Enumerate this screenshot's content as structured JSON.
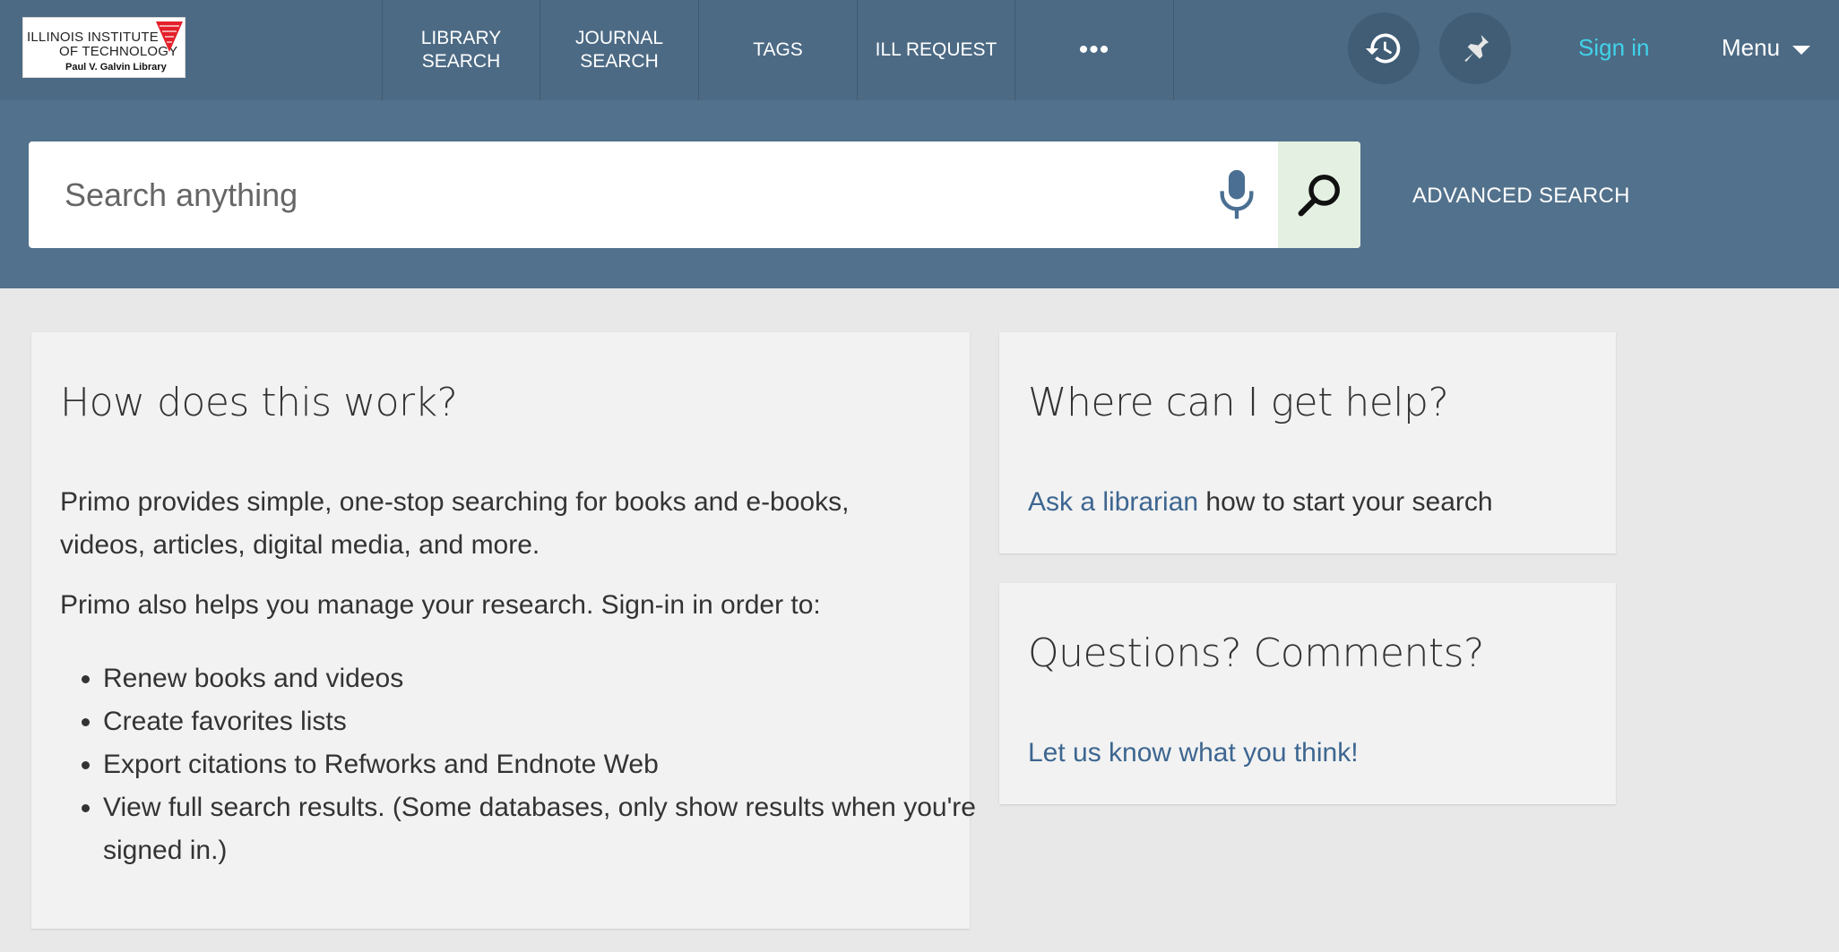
{
  "logo": {
    "line1": "ILLINOIS INSTITUTE",
    "line2": "OF TECHNOLOGY",
    "line3": "Paul V. Galvin Library",
    "colors": {
      "red": "#e4202a"
    }
  },
  "nav": {
    "items": [
      {
        "label": "LIBRARY\nSEARCH"
      },
      {
        "label": "JOURNAL\nSEARCH"
      },
      {
        "label": "TAGS"
      },
      {
        "label": "ILL REQUEST"
      },
      {
        "label": "•••"
      }
    ],
    "history_icon": "history-icon",
    "pin_icon": "pin-icon",
    "signin": "Sign in",
    "menu": "Menu"
  },
  "search": {
    "placeholder": "Search anything",
    "advanced": "ADVANCED SEARCH"
  },
  "cards": {
    "how": {
      "title": "How does this work?",
      "para1": "Primo provides simple, one-stop searching for books and e-books, videos, articles, digital media, and more.",
      "para2": "Primo also helps you manage your research. Sign-in in order to:",
      "bullets": [
        "Renew books and videos",
        "Create favorites lists",
        "Export citations to Refworks and Endnote Web",
        "View full search results. (Some databases, only show results when you're signed in.)"
      ]
    },
    "help": {
      "title": "Where can I get help?",
      "link": "Ask a librarian",
      "text": " how to start your search"
    },
    "questions": {
      "title": "Questions? Comments?",
      "link": "Let us know what you think!"
    }
  },
  "colors": {
    "topbar": "#4c6a84",
    "searchband": "#52718c",
    "signin": "#41d3e9",
    "link": "#3d6690",
    "search_button_bg": "#e4f1e2"
  }
}
